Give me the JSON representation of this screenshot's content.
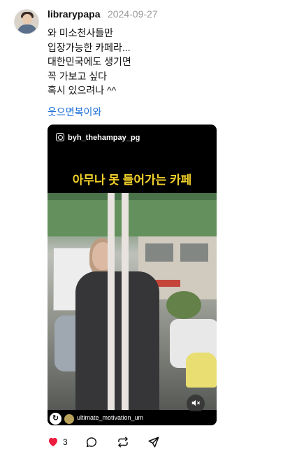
{
  "post": {
    "username": "librarypapa",
    "date": "2024-09-27",
    "text_lines": [
      "와 미소천사들만",
      "입장가능한 카페라...",
      "대한민국에도 생기면",
      "꼭 가보고 싶다",
      "혹시 있으려나 ^^"
    ],
    "hashtag": "웃으면복이와"
  },
  "video": {
    "ig_handle": "byh_thehampay_pg",
    "caption": "아무나 못 들어가는 카페",
    "source_name": "ultimate_motivation_um",
    "repost_glyph": "↻",
    "mute_glyph": "🔇"
  },
  "actions": {
    "like_count": "3",
    "liked": true,
    "like_color": "#ed1c3f"
  }
}
